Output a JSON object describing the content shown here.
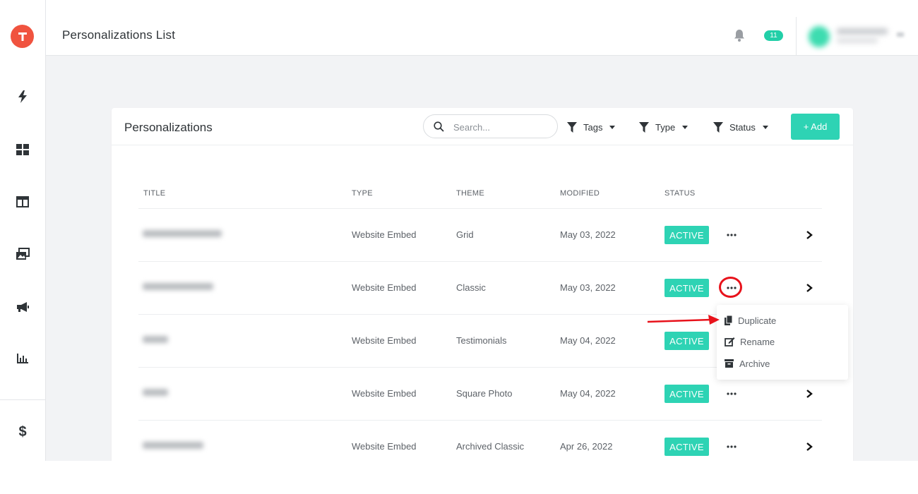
{
  "app": {
    "logo_letter": "T",
    "accent": "#2ed3b4",
    "logo_color": "#f0533f"
  },
  "sidebar": {
    "items": [
      {
        "icon": "bolt-icon"
      },
      {
        "icon": "grid-icon"
      },
      {
        "icon": "layout-icon"
      },
      {
        "icon": "gallery-icon"
      },
      {
        "icon": "megaphone-icon"
      },
      {
        "icon": "bar-chart-icon"
      },
      {
        "icon": "dollar-icon",
        "glyph": "$"
      }
    ]
  },
  "header": {
    "title": "Personalizations List",
    "notification_count": "11"
  },
  "card": {
    "title": "Personalizations",
    "search_placeholder": "Search...",
    "filters": [
      "Tags",
      "Type",
      "Status"
    ],
    "add_label": "+ Add"
  },
  "table": {
    "columns": [
      "TITLE",
      "TYPE",
      "THEME",
      "MODIFIED",
      "STATUS"
    ],
    "rows": [
      {
        "type": "Website Embed",
        "theme": "Grid",
        "modified": "May 03, 2022",
        "status": "ACTIVE"
      },
      {
        "type": "Website Embed",
        "theme": "Classic",
        "modified": "May 03, 2022",
        "status": "ACTIVE"
      },
      {
        "type": "Website Embed",
        "theme": "Testimonials",
        "modified": "May 04, 2022",
        "status": "ACTIVE"
      },
      {
        "type": "Website Embed",
        "theme": "Square Photo",
        "modified": "May 04, 2022",
        "status": "ACTIVE"
      },
      {
        "type": "Website Embed",
        "theme": "Archived Classic",
        "modified": "Apr 26, 2022",
        "status": "ACTIVE"
      }
    ]
  },
  "menu": {
    "items": [
      {
        "label": "Duplicate",
        "icon": "copy-icon"
      },
      {
        "label": "Rename",
        "icon": "edit-icon"
      },
      {
        "label": "Archive",
        "icon": "archive-icon"
      }
    ]
  }
}
